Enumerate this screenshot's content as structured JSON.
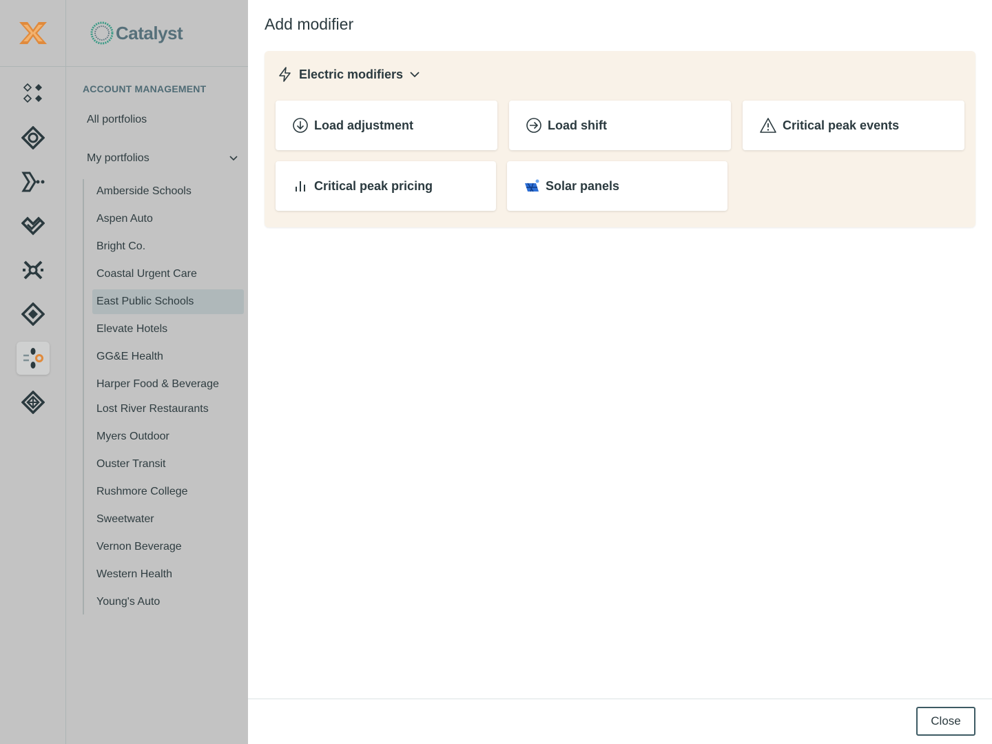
{
  "app": {
    "brand_name": "Catalyst"
  },
  "rail": {
    "items": [
      {
        "icon": "portfolio-diamonds-icon"
      },
      {
        "icon": "target-network-icon"
      },
      {
        "icon": "flow-arrow-icon"
      },
      {
        "icon": "check-diamond-icon"
      },
      {
        "icon": "scatter-x-icon"
      },
      {
        "icon": "diamond-loop-icon"
      },
      {
        "icon": "modifier-icon",
        "active": true
      },
      {
        "icon": "grid-diamond-icon"
      }
    ],
    "colors": {
      "accent": "#e08a3c",
      "icon": "#2b3a3f"
    }
  },
  "sidebar": {
    "section_title": "ACCOUNT MANAGEMENT",
    "all_portfolios": "All portfolios",
    "my_portfolios": "My portfolios",
    "portfolios": [
      "Amberside Schools",
      "Aspen Auto",
      "Bright Co.",
      "Coastal Urgent Care",
      "East Public Schools",
      "Elevate Hotels",
      "GG&E Health",
      "Harper Food & Beverage",
      "Lost River Restaurants",
      "Myers Outdoor",
      "Ouster Transit",
      "Rushmore College",
      "Sweetwater",
      "Vernon Beverage",
      "Western Health",
      "Young's Auto"
    ],
    "selected": "East Public Schools"
  },
  "main": {
    "title": "Add modifier",
    "group_label": "Electric modifiers",
    "modifiers": [
      {
        "label": "Load adjustment",
        "icon": "arrow-down-circle-icon"
      },
      {
        "label": "Load shift",
        "icon": "arrow-right-circle-icon"
      },
      {
        "label": "Critical peak events",
        "icon": "warning-triangle-icon"
      },
      {
        "label": "Critical peak pricing",
        "icon": "bar-chart-icon"
      },
      {
        "label": "Solar panels",
        "icon": "solar-panel-icon"
      }
    ],
    "close_label": "Close"
  }
}
